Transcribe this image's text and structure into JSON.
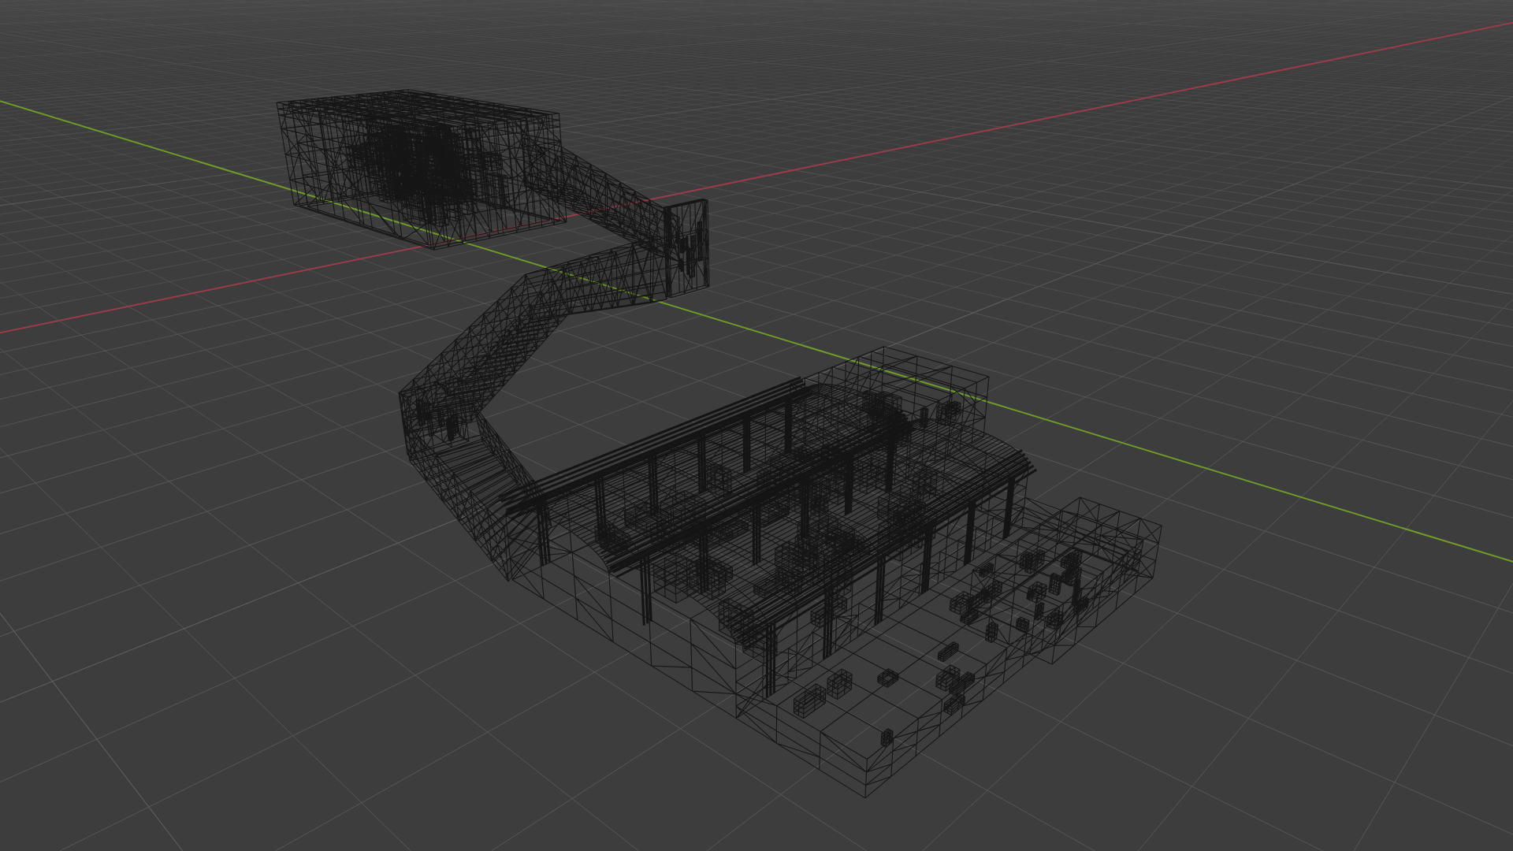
{
  "viewport": {
    "axes": [
      {
        "kind": "x",
        "color": "#983c4c"
      },
      {
        "kind": "y",
        "color": "#6e9b28"
      }
    ]
  }
}
